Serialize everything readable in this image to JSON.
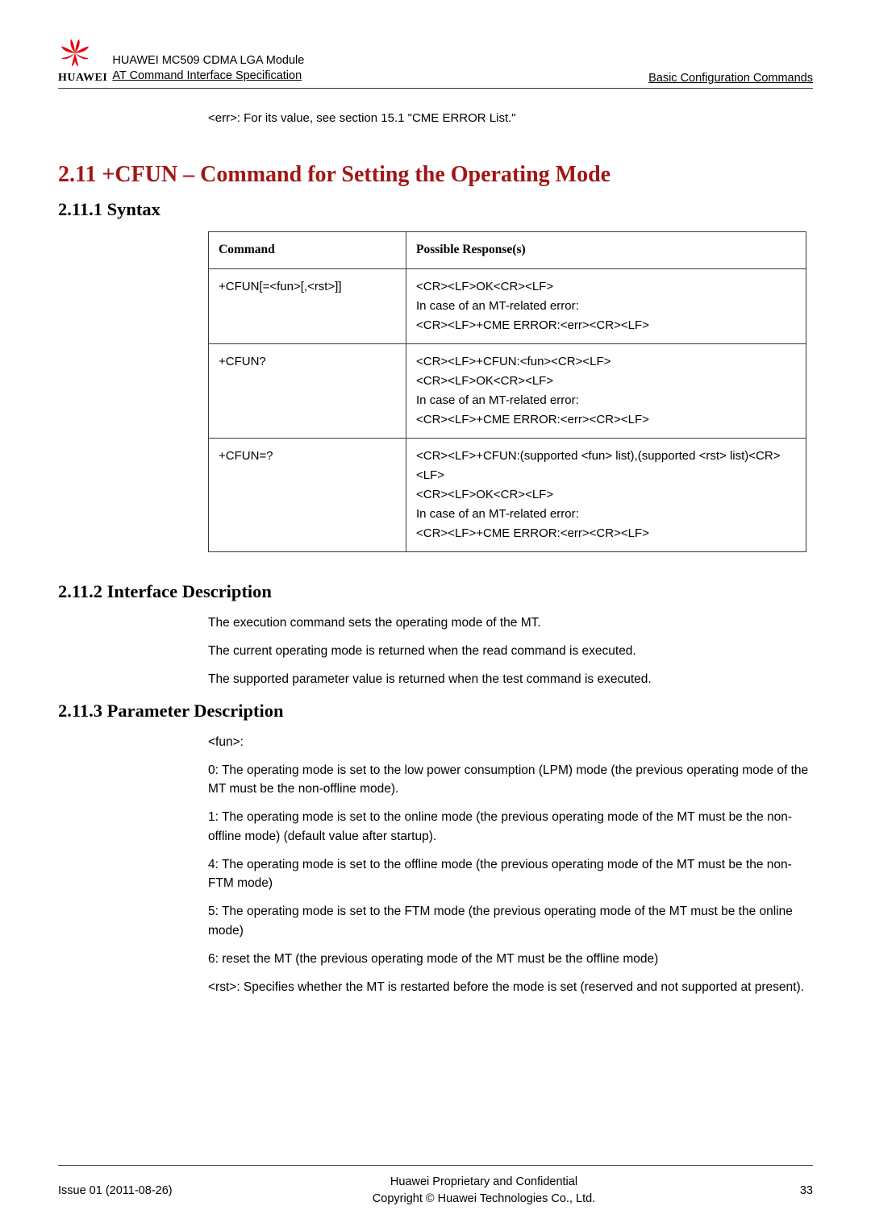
{
  "header": {
    "logo_text": "HUAWEI",
    "doc_line1": "HUAWEI MC509 CDMA LGA Module",
    "doc_line2": "AT Command Interface Specification",
    "right": "Basic Configuration Commands"
  },
  "intro_line": "<err>: For its value, see section 15.1 \"CME ERROR List.\"",
  "h1": "2.11 +CFUN – Command for Setting the Operating Mode",
  "h2_syntax": "2.11.1 Syntax",
  "table": {
    "head_col1": "Command",
    "head_col2": "Possible Response(s)",
    "rows": [
      {
        "c1": "+CFUN[=<fun>[,<rst>]]",
        "c2": "<CR><LF>OK<CR><LF>\nIn case of an MT-related error:\n<CR><LF>+CME ERROR:<err><CR><LF>"
      },
      {
        "c1": "+CFUN?",
        "c2": "<CR><LF>+CFUN:<fun><CR><LF>\n<CR><LF>OK<CR><LF>\nIn case of an MT-related error:\n<CR><LF>+CME ERROR:<err><CR><LF>"
      },
      {
        "c1": "+CFUN=?",
        "c2": "<CR><LF>+CFUN:(supported <fun> list),(supported <rst> list)<CR><LF>\n<CR><LF>OK<CR><LF>\nIn case of an MT-related error:\n<CR><LF>+CME ERROR:<err><CR><LF>"
      }
    ]
  },
  "h2_interface": "2.11.2 Interface Description",
  "interface_p1": "The execution command sets the operating mode of the MT.",
  "interface_p2": "The current operating mode is returned when the read command is executed.",
  "interface_p3": "The supported parameter value is returned when the test command is executed.",
  "h2_param": "2.11.3 Parameter Description",
  "param_fun": "<fun>:",
  "param_0": "0: The operating mode is set to the low power consumption (LPM) mode (the previous operating mode of the MT must be the non-offline mode).",
  "param_1": "1: The operating mode is set to the online mode (the previous operating mode of the MT must be the non-offline mode) (default value after startup).",
  "param_4": "4: The operating mode is set to the offline mode (the previous operating mode of the MT must be the non-FTM mode)",
  "param_5": "5: The operating mode is set to the FTM mode (the previous operating mode of the MT must be the online mode)",
  "param_6": "6: reset the MT (the previous operating mode of the MT must be the offline mode)",
  "param_rst": "<rst>: Specifies whether the MT is restarted before the mode is set (reserved and not supported at present).",
  "footer": {
    "left": "Issue 01 (2011-08-26)",
    "center_l1": "Huawei Proprietary and Confidential",
    "center_l2": "Copyright © Huawei Technologies Co., Ltd.",
    "right": "33"
  }
}
